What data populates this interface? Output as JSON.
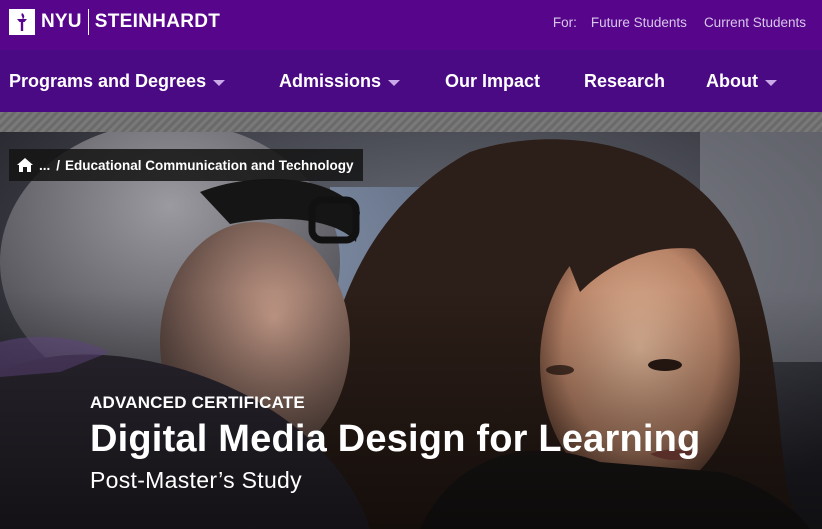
{
  "header": {
    "logo_primary": "NYU",
    "logo_secondary": "STEINHARDT",
    "audience_label": "For:",
    "audience_links": [
      "Future Students",
      "Current Students"
    ]
  },
  "nav": {
    "items": [
      {
        "label": "Programs and Degrees",
        "has_dropdown": true
      },
      {
        "label": "Admissions",
        "has_dropdown": true
      },
      {
        "label": "Our Impact",
        "has_dropdown": false
      },
      {
        "label": "Research",
        "has_dropdown": false
      },
      {
        "label": "About",
        "has_dropdown": true
      }
    ]
  },
  "breadcrumb": {
    "ellipsis": "...",
    "separator": "/",
    "current": "Educational Communication and Technology"
  },
  "hero": {
    "eyebrow": "ADVANCED CERTIFICATE",
    "title": "Digital Media Design for Learning",
    "subtitle": "Post-Master’s Study"
  },
  "colors": {
    "brand_purple": "#57068c",
    "nav_purple": "#4a0a84",
    "audience_text": "#d8c6ea"
  },
  "icons": {
    "logo": "nyu-torch-icon",
    "home": "home-icon",
    "dropdown": "caret-down-icon"
  }
}
